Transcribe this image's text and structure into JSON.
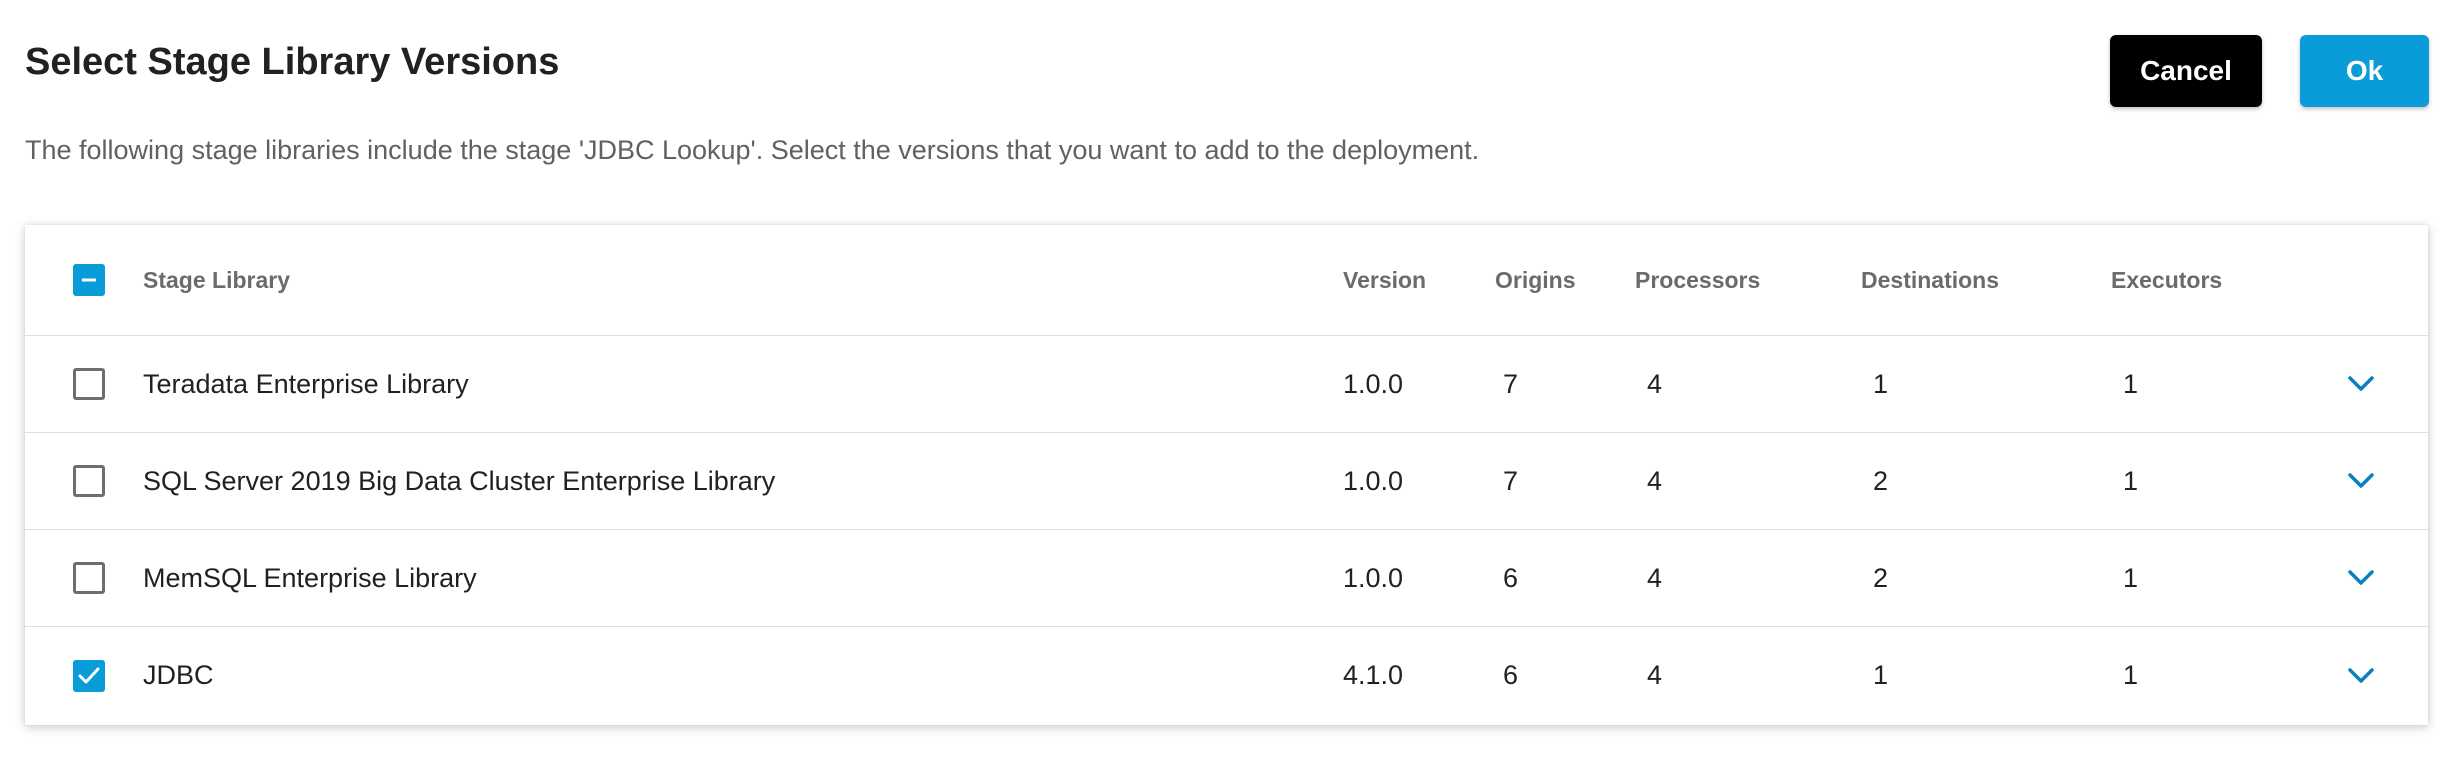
{
  "dialog": {
    "title": "Select Stage Library Versions",
    "description": "The following stage libraries include the stage 'JDBC Lookup'. Select the versions that you want to add to the deployment.",
    "cancel_label": "Cancel",
    "ok_label": "Ok"
  },
  "table": {
    "headers": {
      "library": "Stage Library",
      "version": "Version",
      "origins": "Origins",
      "processors": "Processors",
      "destinations": "Destinations",
      "executors": "Executors"
    },
    "select_all_state": "indeterminate",
    "rows": [
      {
        "library": "Teradata Enterprise Library",
        "version": "1.0.0",
        "origins": "7",
        "processors": "4",
        "destinations": "1",
        "executors": "1",
        "checked": false
      },
      {
        "library": "SQL Server 2019 Big Data Cluster Enterprise Library",
        "version": "1.0.0",
        "origins": "7",
        "processors": "4",
        "destinations": "2",
        "executors": "1",
        "checked": false
      },
      {
        "library": "MemSQL Enterprise Library",
        "version": "1.0.0",
        "origins": "6",
        "processors": "4",
        "destinations": "2",
        "executors": "1",
        "checked": false
      },
      {
        "library": "JDBC",
        "version": "4.1.0",
        "origins": "6",
        "processors": "4",
        "destinations": "1",
        "executors": "1",
        "checked": true
      }
    ]
  },
  "icons": {
    "select_all": "minus-icon",
    "checked": "check-icon",
    "expand": "chevron-down-icon"
  },
  "colors": {
    "accent": "#0a9bd9",
    "cancel_bg": "#000000",
    "text": "#212121",
    "muted": "#616161"
  }
}
